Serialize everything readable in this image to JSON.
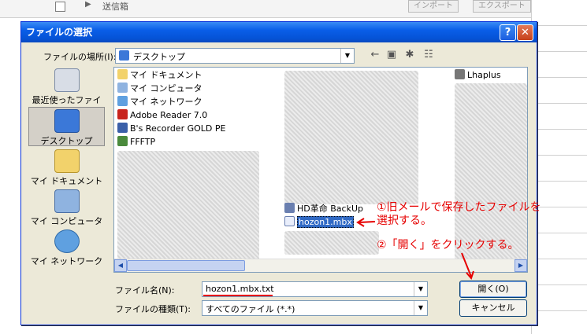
{
  "background": {
    "folder_label": "送信箱",
    "import_button": "インポート",
    "export_button": "エクスポート"
  },
  "dialog": {
    "title": "ファイルの選択",
    "help_button": "?",
    "close_button": "✕",
    "location_label": "ファイルの場所(I):",
    "location_value": "デスクトップ",
    "places": [
      {
        "label": "最近使ったファイル",
        "icon": "recent-icon"
      },
      {
        "label": "デスクトップ",
        "icon": "desktop-icon"
      },
      {
        "label": "マイ ドキュメント",
        "icon": "documents-icon"
      },
      {
        "label": "マイ コンピュータ",
        "icon": "computer-icon"
      },
      {
        "label": "マイ ネットワーク",
        "icon": "network-icon"
      }
    ],
    "files_col1": [
      "マイ ドキュメント",
      "マイ コンピュータ",
      "マイ ネットワーク",
      "Adobe Reader 7.0",
      "B's Recorder GOLD PE",
      "FFFTP",
      "",
      "",
      "",
      "",
      "",
      "",
      "",
      ""
    ],
    "files_col2": [
      "",
      "",
      "",
      "",
      "",
      "",
      "",
      "",
      "",
      "",
      "HD革命 BackUp",
      "hozon1.mbx",
      "",
      ""
    ],
    "files_col3": [
      "Lhaplus",
      "",
      "",
      "",
      "",
      "",
      "",
      "",
      "",
      "",
      "",
      "",
      "",
      ""
    ],
    "filename_label": "ファイル名(N):",
    "filename_value": "hozon1.mbx.txt",
    "filetype_label": "ファイルの種類(T):",
    "filetype_value": "すべてのファイル (*.*)",
    "open_button": "開く(O)",
    "cancel_button": "キャンセル"
  },
  "annotations": {
    "step1_line1": "①旧メールで保存したファイルを",
    "step1_line2": "選択する。",
    "step2": "②「開く」をクリックする。"
  }
}
